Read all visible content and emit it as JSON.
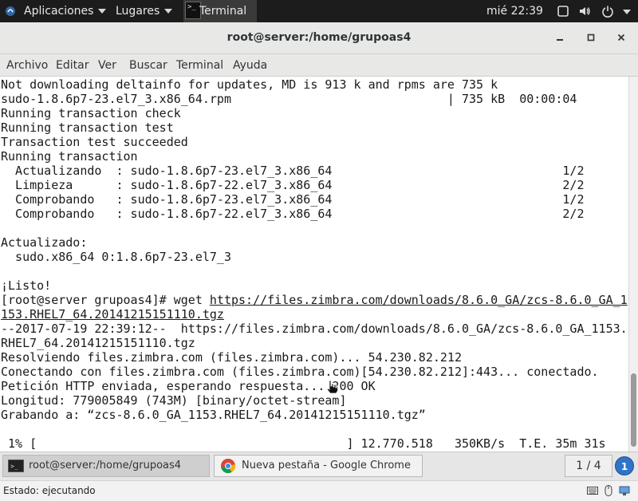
{
  "top_panel": {
    "applications": "Aplicaciones",
    "places": "Lugares",
    "terminal_app": "Terminal",
    "clock": "mié 22:39"
  },
  "window": {
    "title": "root@server:/home/grupoas4",
    "menu": [
      "Archivo",
      "Editar",
      "Ver",
      "Buscar",
      "Terminal",
      "Ayuda"
    ]
  },
  "terminal": {
    "lines": [
      "Not downloading deltainfo for updates, MD is 913 k and rpms are 735 k",
      "sudo-1.8.6p7-23.el7_3.x86_64.rpm                              | 735 kB  00:00:04",
      "Running transaction check",
      "Running transaction test",
      "Transaction test succeeded",
      "Running transaction",
      "  Actualizando  : sudo-1.8.6p7-23.el7_3.x86_64                                1/2",
      "  Limpieza      : sudo-1.8.6p7-22.el7_3.x86_64                                2/2",
      "  Comprobando   : sudo-1.8.6p7-23.el7_3.x86_64                                1/2",
      "  Comprobando   : sudo-1.8.6p7-22.el7_3.x86_64                                2/2",
      "",
      "Actualizado:",
      "  sudo.x86_64 0:1.8.6p7-23.el7_3",
      "",
      "¡Listo!",
      "",
      "153.RHEL7_64.20141215151110.tgz",
      "--2017-07-19 22:39:12--  https://files.zimbra.com/downloads/8.6.0_GA/zcs-8.6.0_GA_1153.",
      "RHEL7_64.20141215151110.tgz",
      "Resolviendo files.zimbra.com (files.zimbra.com)... 54.230.82.212",
      "Conectando con files.zimbra.com (files.zimbra.com)[54.230.82.212]:443... conectado.",
      "Petición HTTP enviada, esperando respuesta... 200 OK",
      "Longitud: 779005849 (743M) [binary/octet-stream]",
      "Grabando a: “zcs-8.6.0_GA_1153.RHEL7_64.20141215151110.tgz”",
      "",
      " 1% [                                           ] 12.770.518   350KB/s  T.E. 35m 31s"
    ],
    "prompt": "[root@server grupoas4]# wget ",
    "wget_url": "https://files.zimbra.com/downloads/8.6.0_GA/zcs-8.6.0_GA_1"
  },
  "taskbar": {
    "tasks": [
      {
        "label": "root@server:/home/grupoas4",
        "active": true
      },
      {
        "label": "Nueva pestaña - Google Chrome",
        "active": false
      }
    ],
    "workspace": "1 / 4",
    "badge": "1"
  },
  "status": {
    "text": "Estado: ejecutando"
  },
  "colors": {
    "panel_bg": "#1c1c1c",
    "terminal_bg": "#ffffff",
    "terminal_fg": "#1a1a1a",
    "badge_blue": "#2e74c9"
  }
}
